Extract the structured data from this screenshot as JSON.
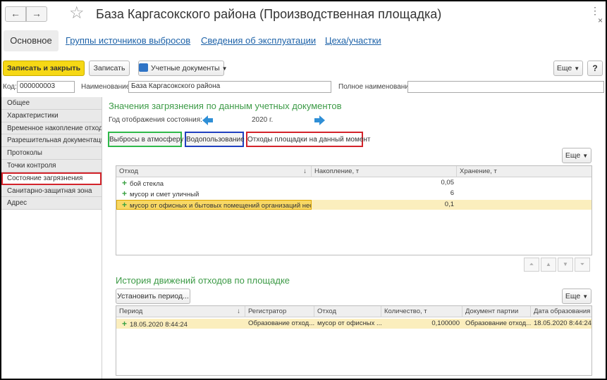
{
  "window": {
    "title": "База Каргасокского района (Производственная площадка)",
    "back": "←",
    "forward": "→",
    "favorite": "☆",
    "more": "⋮",
    "close": "×"
  },
  "tabs": [
    {
      "label": "Основное",
      "active": true
    },
    {
      "label": "Группы источников выбросов"
    },
    {
      "label": "Сведения об эксплуатации"
    },
    {
      "label": "Цеха/участки"
    }
  ],
  "toolbar": {
    "save_close": "Записать и закрыть",
    "save": "Записать",
    "docs": "Учетные документы",
    "more": "Еще",
    "help": "?"
  },
  "fields": {
    "code_label": "Код:",
    "code_value": "000000003",
    "name_label": "Наименование:",
    "name_value": "База Каргасокского района",
    "fullname_label": "Полное наименование:",
    "fullname_value": ""
  },
  "sidebar": {
    "items": [
      {
        "label": "Общее"
      },
      {
        "label": "Характеристики"
      },
      {
        "label": "Временное накопление отходов"
      },
      {
        "label": "Разрешительная документация"
      },
      {
        "label": "Протоколы"
      },
      {
        "label": "Точки контроля"
      },
      {
        "label": "Состояние загрязнения",
        "selected": true
      },
      {
        "label": "Санитарно-защитная зона"
      },
      {
        "label": "Адрес"
      }
    ]
  },
  "pollution": {
    "title": "Значения загрязнения по данным учетных документов",
    "year_label": "Год отображения состояния:",
    "year_value": "2020 г.",
    "subtabs": [
      "Выбросы в атмосферу",
      "Водопользование",
      "Отходы площадки на данный момент"
    ],
    "more": "Еще",
    "table": {
      "headers": [
        "Отход",
        "Накопление, т",
        "Хранение, т"
      ],
      "sort_indicator": "↓",
      "rows": [
        {
          "name": "бой стекла",
          "accum": "0,05",
          "storage": ""
        },
        {
          "name": "мусор и смет уличный",
          "accum": "6",
          "storage": ""
        },
        {
          "name": "мусор от офисных и бытовых помещений организаций нес...",
          "accum": "0,1",
          "storage": "",
          "selected": true
        }
      ]
    }
  },
  "history": {
    "title": "История движений отходов по площадке",
    "set_period": "Установить период...",
    "more": "Еще",
    "table": {
      "headers": [
        "Период",
        "Регистратор",
        "Отход",
        "Количество, т",
        "Документ партии",
        "Дата образования"
      ],
      "sort_indicator": "↓",
      "rows": [
        {
          "period": "18.05.2020 8:44:24",
          "registrar": "Образование отход...",
          "waste": "мусор от офисных ...",
          "qty": "0,100000",
          "doc": "Образование отход...",
          "date": "18.05.2020 8:44:24"
        }
      ]
    }
  },
  "colors": {
    "accent_green": "#3d9b47",
    "link_blue": "#1d62a8",
    "primary_yellow": "#f6d815",
    "selection_yellow": "#fbeebd"
  },
  "icons": {
    "year_prev": "arrow-left-icon",
    "year_next": "arrow-right-icon",
    "row_add": "plus-icon"
  }
}
